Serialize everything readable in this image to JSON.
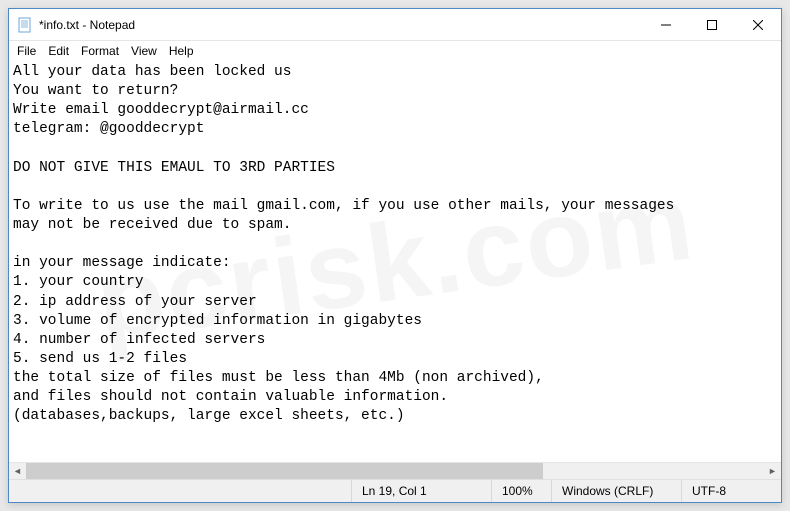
{
  "window": {
    "title": "*info.txt - Notepad"
  },
  "menubar": {
    "file": "File",
    "edit": "Edit",
    "format": "Format",
    "view": "View",
    "help": "Help"
  },
  "content": {
    "text": "All your data has been locked us\nYou want to return?\nWrite email gooddecrypt@airmail.cc\ntelegram: @gooddecrypt\n\nDO NOT GIVE THIS EMAUL TO 3RD PARTIES\n\nTo write to us use the mail gmail.com, if you use other mails, your messages\nmay not be received due to spam.\n\nin your message indicate:\n1. your country\n2. ip address of your server\n3. volume of encrypted information in gigabytes\n4. number of infected servers\n5. send us 1-2 files\nthe total size of files must be less than 4Mb (non archived),\nand files should not contain valuable information.\n(databases,backups, large excel sheets, etc.)"
  },
  "statusbar": {
    "position": "Ln 19, Col 1",
    "zoom": "100%",
    "lineending": "Windows (CRLF)",
    "encoding": "UTF-8"
  },
  "watermark": "pcrisk.com"
}
